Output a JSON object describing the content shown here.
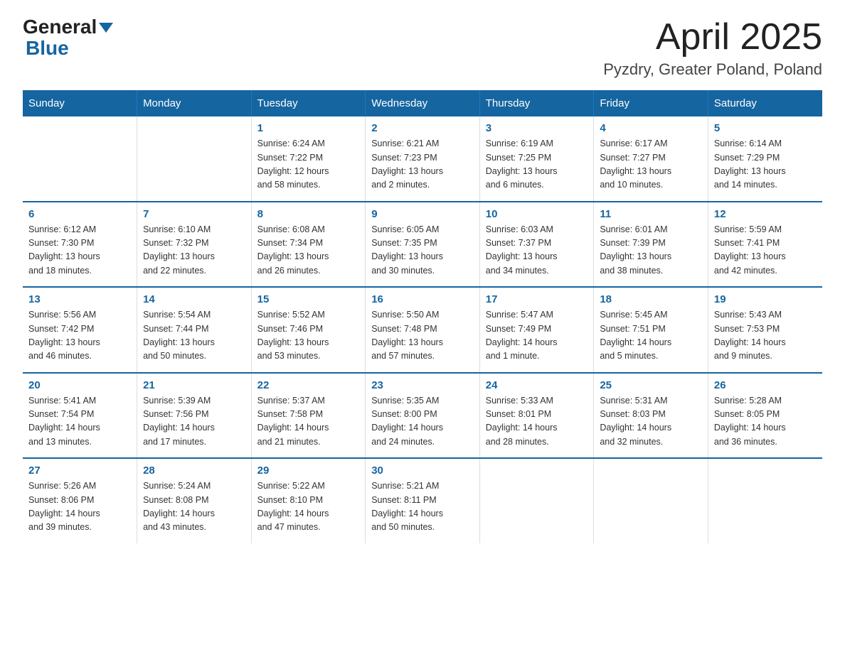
{
  "header": {
    "logo_general": "General",
    "logo_blue": "Blue",
    "title": "April 2025",
    "location": "Pyzdry, Greater Poland, Poland"
  },
  "days_of_week": [
    "Sunday",
    "Monday",
    "Tuesday",
    "Wednesday",
    "Thursday",
    "Friday",
    "Saturday"
  ],
  "weeks": [
    [
      {
        "day": "",
        "info": ""
      },
      {
        "day": "",
        "info": ""
      },
      {
        "day": "1",
        "info": "Sunrise: 6:24 AM\nSunset: 7:22 PM\nDaylight: 12 hours\nand 58 minutes."
      },
      {
        "day": "2",
        "info": "Sunrise: 6:21 AM\nSunset: 7:23 PM\nDaylight: 13 hours\nand 2 minutes."
      },
      {
        "day": "3",
        "info": "Sunrise: 6:19 AM\nSunset: 7:25 PM\nDaylight: 13 hours\nand 6 minutes."
      },
      {
        "day": "4",
        "info": "Sunrise: 6:17 AM\nSunset: 7:27 PM\nDaylight: 13 hours\nand 10 minutes."
      },
      {
        "day": "5",
        "info": "Sunrise: 6:14 AM\nSunset: 7:29 PM\nDaylight: 13 hours\nand 14 minutes."
      }
    ],
    [
      {
        "day": "6",
        "info": "Sunrise: 6:12 AM\nSunset: 7:30 PM\nDaylight: 13 hours\nand 18 minutes."
      },
      {
        "day": "7",
        "info": "Sunrise: 6:10 AM\nSunset: 7:32 PM\nDaylight: 13 hours\nand 22 minutes."
      },
      {
        "day": "8",
        "info": "Sunrise: 6:08 AM\nSunset: 7:34 PM\nDaylight: 13 hours\nand 26 minutes."
      },
      {
        "day": "9",
        "info": "Sunrise: 6:05 AM\nSunset: 7:35 PM\nDaylight: 13 hours\nand 30 minutes."
      },
      {
        "day": "10",
        "info": "Sunrise: 6:03 AM\nSunset: 7:37 PM\nDaylight: 13 hours\nand 34 minutes."
      },
      {
        "day": "11",
        "info": "Sunrise: 6:01 AM\nSunset: 7:39 PM\nDaylight: 13 hours\nand 38 minutes."
      },
      {
        "day": "12",
        "info": "Sunrise: 5:59 AM\nSunset: 7:41 PM\nDaylight: 13 hours\nand 42 minutes."
      }
    ],
    [
      {
        "day": "13",
        "info": "Sunrise: 5:56 AM\nSunset: 7:42 PM\nDaylight: 13 hours\nand 46 minutes."
      },
      {
        "day": "14",
        "info": "Sunrise: 5:54 AM\nSunset: 7:44 PM\nDaylight: 13 hours\nand 50 minutes."
      },
      {
        "day": "15",
        "info": "Sunrise: 5:52 AM\nSunset: 7:46 PM\nDaylight: 13 hours\nand 53 minutes."
      },
      {
        "day": "16",
        "info": "Sunrise: 5:50 AM\nSunset: 7:48 PM\nDaylight: 13 hours\nand 57 minutes."
      },
      {
        "day": "17",
        "info": "Sunrise: 5:47 AM\nSunset: 7:49 PM\nDaylight: 14 hours\nand 1 minute."
      },
      {
        "day": "18",
        "info": "Sunrise: 5:45 AM\nSunset: 7:51 PM\nDaylight: 14 hours\nand 5 minutes."
      },
      {
        "day": "19",
        "info": "Sunrise: 5:43 AM\nSunset: 7:53 PM\nDaylight: 14 hours\nand 9 minutes."
      }
    ],
    [
      {
        "day": "20",
        "info": "Sunrise: 5:41 AM\nSunset: 7:54 PM\nDaylight: 14 hours\nand 13 minutes."
      },
      {
        "day": "21",
        "info": "Sunrise: 5:39 AM\nSunset: 7:56 PM\nDaylight: 14 hours\nand 17 minutes."
      },
      {
        "day": "22",
        "info": "Sunrise: 5:37 AM\nSunset: 7:58 PM\nDaylight: 14 hours\nand 21 minutes."
      },
      {
        "day": "23",
        "info": "Sunrise: 5:35 AM\nSunset: 8:00 PM\nDaylight: 14 hours\nand 24 minutes."
      },
      {
        "day": "24",
        "info": "Sunrise: 5:33 AM\nSunset: 8:01 PM\nDaylight: 14 hours\nand 28 minutes."
      },
      {
        "day": "25",
        "info": "Sunrise: 5:31 AM\nSunset: 8:03 PM\nDaylight: 14 hours\nand 32 minutes."
      },
      {
        "day": "26",
        "info": "Sunrise: 5:28 AM\nSunset: 8:05 PM\nDaylight: 14 hours\nand 36 minutes."
      }
    ],
    [
      {
        "day": "27",
        "info": "Sunrise: 5:26 AM\nSunset: 8:06 PM\nDaylight: 14 hours\nand 39 minutes."
      },
      {
        "day": "28",
        "info": "Sunrise: 5:24 AM\nSunset: 8:08 PM\nDaylight: 14 hours\nand 43 minutes."
      },
      {
        "day": "29",
        "info": "Sunrise: 5:22 AM\nSunset: 8:10 PM\nDaylight: 14 hours\nand 47 minutes."
      },
      {
        "day": "30",
        "info": "Sunrise: 5:21 AM\nSunset: 8:11 PM\nDaylight: 14 hours\nand 50 minutes."
      },
      {
        "day": "",
        "info": ""
      },
      {
        "day": "",
        "info": ""
      },
      {
        "day": "",
        "info": ""
      }
    ]
  ]
}
